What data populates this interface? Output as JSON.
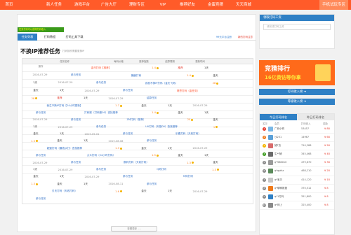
{
  "topnav": {
    "items": [
      "首页",
      "新人任务",
      "游戏平台",
      "广告大厅",
      "理财专区",
      "VIP",
      "推荐好友",
      "金蛋竞猜",
      "天天商城"
    ],
    "mobile_label": "手机试玩专区",
    "color": "#ff5b29"
  },
  "banner": "任务打码可以获得打码收入",
  "tabs": {
    "items": [
      "任务列表",
      "打码教程",
      "打码工具下载"
    ],
    "link_register": "99元平台注册",
    "link_about": "新的打码注意"
  },
  "section": {
    "title": "不换IP推荐任务",
    "subtitle": "打码操作需要更换IP"
  },
  "table": {
    "headers": [
      "任务名称",
      "每码价格",
      "推荐指数",
      "结算周期",
      "更新时间",
      "操作"
    ],
    "rows": [
      {
        "name": "金币打码【推荐】",
        "red": true,
        "price": "1.4",
        "rec": "推荐",
        "cycle": "1天",
        "date": "2016-07-29",
        "action": "参与任务"
      },
      {
        "name": "脆脆打码",
        "red": false,
        "price": "1.4",
        "rec": "金天",
        "cycle": "1天",
        "date": "2016-07-29",
        "action": "参与任务"
      },
      {
        "name": "我发不换IP打码（金天飞码）",
        "red": false,
        "price": "28",
        "rec": "金天",
        "cycle": "1天",
        "date": "2016-07-29",
        "action": "参与任务"
      },
      {
        "name": "哥思打码（金任务）",
        "red": true,
        "price": "28",
        "rec": "推荐",
        "cycle": "1天",
        "date": "2016-07-29",
        "action": "结算任务"
      },
      {
        "name": "我生不换IP打码【24小时更新】",
        "red": false,
        "price": "1.7",
        "rec": "金天",
        "cycle": "1天",
        "date": "2016-07-29",
        "action": "参与任务"
      },
      {
        "name": "打码账（打码账00）查找推荐",
        "red": false,
        "price": "1.4",
        "rec": "金天",
        "cycle": "1天",
        "date": "2016-07-29",
        "action": "参与任务"
      },
      {
        "name": "ZM打码（推荐）",
        "red": false,
        "price": "20",
        "rec": "金天",
        "cycle": "1天",
        "date": "2016-07-29",
        "action": "参与任务"
      },
      {
        "name": "UU打码（天猫00）查找推荐",
        "red": false,
        "price": "1",
        "rec": "金天",
        "cycle": "1天",
        "date": "2015-05-01",
        "action": "参与任务"
      },
      {
        "name": "乐趣打码（天收打码）",
        "red": false,
        "price": "1.3",
        "rec": "金天",
        "cycle": "1天",
        "date": "2015-08-08",
        "action": "参与任务"
      },
      {
        "name": "超速打码（赚钱从打）查找推荐",
        "red": false,
        "price": "1.3",
        "rec": "金天",
        "cycle": "1天",
        "date": "2016-07-29",
        "action": "参与任务"
      },
      {
        "name": "大众打码（24小时打码）",
        "red": false,
        "price": "1.5",
        "rec": "金天",
        "cycle": "1天",
        "date": "2016-07-29",
        "action": "参与任务"
      },
      {
        "name": "数码打码（天收打码）",
        "red": false,
        "price": "1.3",
        "rec": "金天",
        "cycle": "1天",
        "date": "2016-07-29",
        "action": "参与任务"
      },
      {
        "name": "Q码打码",
        "red": false,
        "price": "1.3",
        "rec": "金天",
        "cycle": "1天",
        "date": "2016-07-29",
        "action": "参与任务"
      },
      {
        "name": "M码打码",
        "red": false,
        "price": "1.3",
        "rec": "金天",
        "cycle": "1天",
        "date": "2016-08-11",
        "action": "参与任务"
      },
      {
        "name": "贝氏打码（天收打码）",
        "red": false,
        "price": "1.6",
        "rec": "金天",
        "cycle": "1天",
        "date": "2016-07-29",
        "action": "参与任务"
      }
    ]
  },
  "more_label": "查看更多 ....",
  "login": {
    "head": "领取打码工资",
    "input_placeholder": "请完成打码工资"
  },
  "ad": {
    "line1": "竞猜排行",
    "line2": "16亿黄钻等你拿"
  },
  "side_buttons": {
    "income": "打码收入榜 ➔",
    "level": "等级收入榜 ➔"
  },
  "ranking": {
    "tabs": [
      "今日打码排名",
      "昨日打码排名"
    ],
    "headers": [
      "名次",
      "会员",
      "打码收入",
      "奖励"
    ],
    "rows": [
      {
        "num": "1",
        "color": "#e63c2e",
        "avatar": "#7ab8e6",
        "name": "广西小鸭",
        "income": "53457",
        "reward": "¥ 88"
      },
      {
        "num": "2",
        "color": "#f07a1a",
        "avatar": "#5aa0d8",
        "name": "沙231",
        "income": "14967",
        "reward": "¥ 68"
      },
      {
        "num": "3",
        "color": "#f5b400",
        "avatar": "#d86a6a",
        "name": "猪T虫",
        "income": "710,288",
        "reward": "¥ 58"
      },
      {
        "num": "4",
        "color": "#3a9a1a",
        "avatar": "#6a6a6a",
        "name": "生**猪",
        "income": "345,468",
        "reward": "¥ 48"
      },
      {
        "num": "5",
        "color": "#888888",
        "avatar": "#9a9a9a",
        "name": "q*586010",
        "income": "479,670",
        "reward": "¥ 38"
      },
      {
        "num": "6",
        "color": "#888888",
        "avatar": "#5a8a5a",
        "name": "q*qpfsz",
        "income": "468,210",
        "reward": "¥ 28"
      },
      {
        "num": "7",
        "color": "#888888",
        "avatar": "#c8c8c8",
        "name": "q*宝贝",
        "income": "414,120",
        "reward": "¥ 18"
      },
      {
        "num": "8",
        "color": "#888888",
        "avatar": "#f07a1a",
        "name": "q*聊聊数据",
        "income": "370,512",
        "reward": "¥ 8"
      },
      {
        "num": "9",
        "color": "#888888",
        "avatar": "#2f80c5",
        "name": "q*1打码",
        "income": "351,800",
        "reward": "¥ 8"
      },
      {
        "num": "10",
        "color": "#888888",
        "avatar": "#888888",
        "name": "q*网上",
        "income": "325,400",
        "reward": "¥ 8"
      }
    ]
  }
}
